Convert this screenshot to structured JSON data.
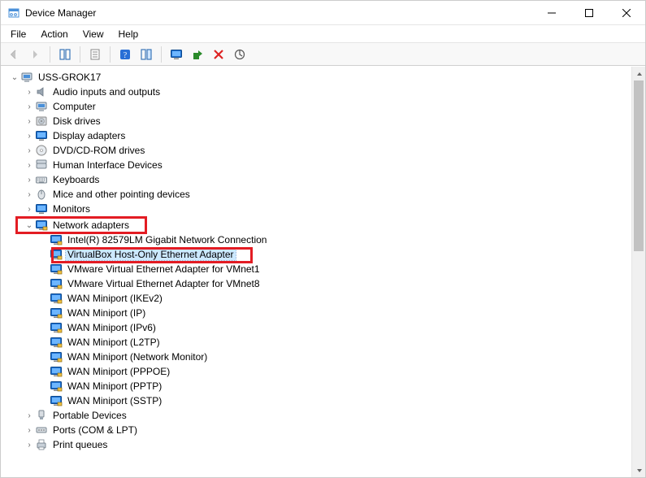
{
  "window": {
    "title": "Device Manager"
  },
  "menu": {
    "file": "File",
    "action": "Action",
    "view": "View",
    "help": "Help"
  },
  "tree": {
    "root": "USS-GROK17",
    "cat_audio": "Audio inputs and outputs",
    "cat_computer": "Computer",
    "cat_disk": "Disk drives",
    "cat_display": "Display adapters",
    "cat_dvd": "DVD/CD-ROM drives",
    "cat_hid": "Human Interface Devices",
    "cat_keyboards": "Keyboards",
    "cat_mice": "Mice and other pointing devices",
    "cat_monitors": "Monitors",
    "cat_network": "Network adapters",
    "net": {
      "intel": "Intel(R) 82579LM Gigabit Network Connection",
      "vbox": "VirtualBox Host-Only Ethernet Adapter",
      "vm1": "VMware Virtual Ethernet Adapter for VMnet1",
      "vm8": "VMware Virtual Ethernet Adapter for VMnet8",
      "wan_ikev2": "WAN Miniport (IKEv2)",
      "wan_ip": "WAN Miniport (IP)",
      "wan_ipv6": "WAN Miniport (IPv6)",
      "wan_l2tp": "WAN Miniport (L2TP)",
      "wan_netmon": "WAN Miniport (Network Monitor)",
      "wan_pppoe": "WAN Miniport (PPPOE)",
      "wan_pptp": "WAN Miniport (PPTP)",
      "wan_sstp": "WAN Miniport (SSTP)"
    },
    "cat_portable": "Portable Devices",
    "cat_ports": "Ports (COM & LPT)",
    "cat_printq": "Print queues"
  }
}
